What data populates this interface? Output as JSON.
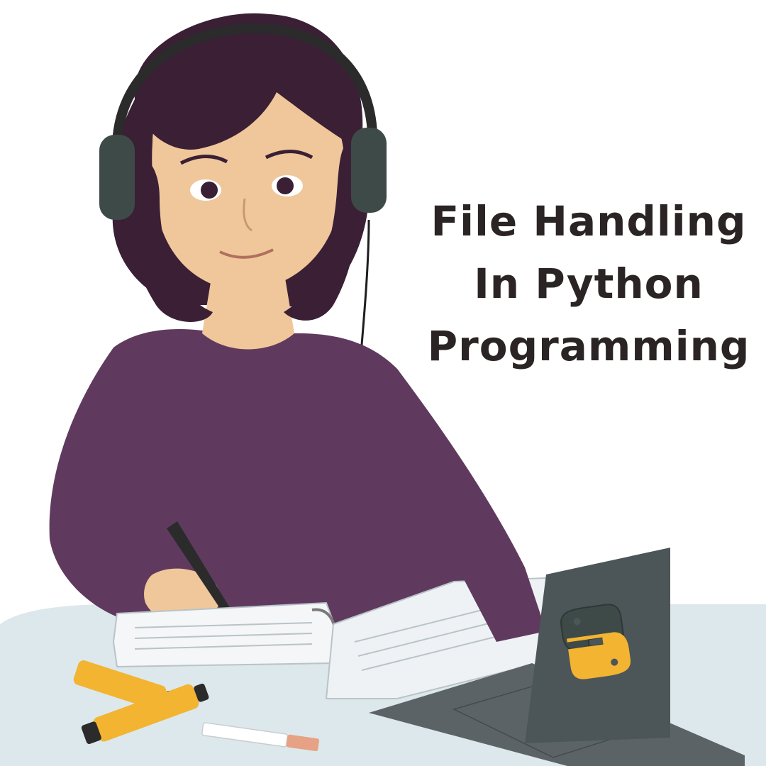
{
  "headline": {
    "line1": "File Handling",
    "line2": "In Python",
    "line3": "Programming"
  },
  "colors": {
    "background": "#ffffff",
    "text": "#2b2424",
    "hair": "#3a1f35",
    "skin": "#f0c79a",
    "sweater": "#5f3a5e",
    "headphones": "#3e4a48",
    "desk": "#dde8ec",
    "laptop": "#4c5558",
    "python_logo_blue": "#3e4a48",
    "python_logo_yellow": "#f2b431",
    "highlighter": "#f2b431"
  },
  "icons": {
    "laptop_logo": "python-logo-icon"
  }
}
